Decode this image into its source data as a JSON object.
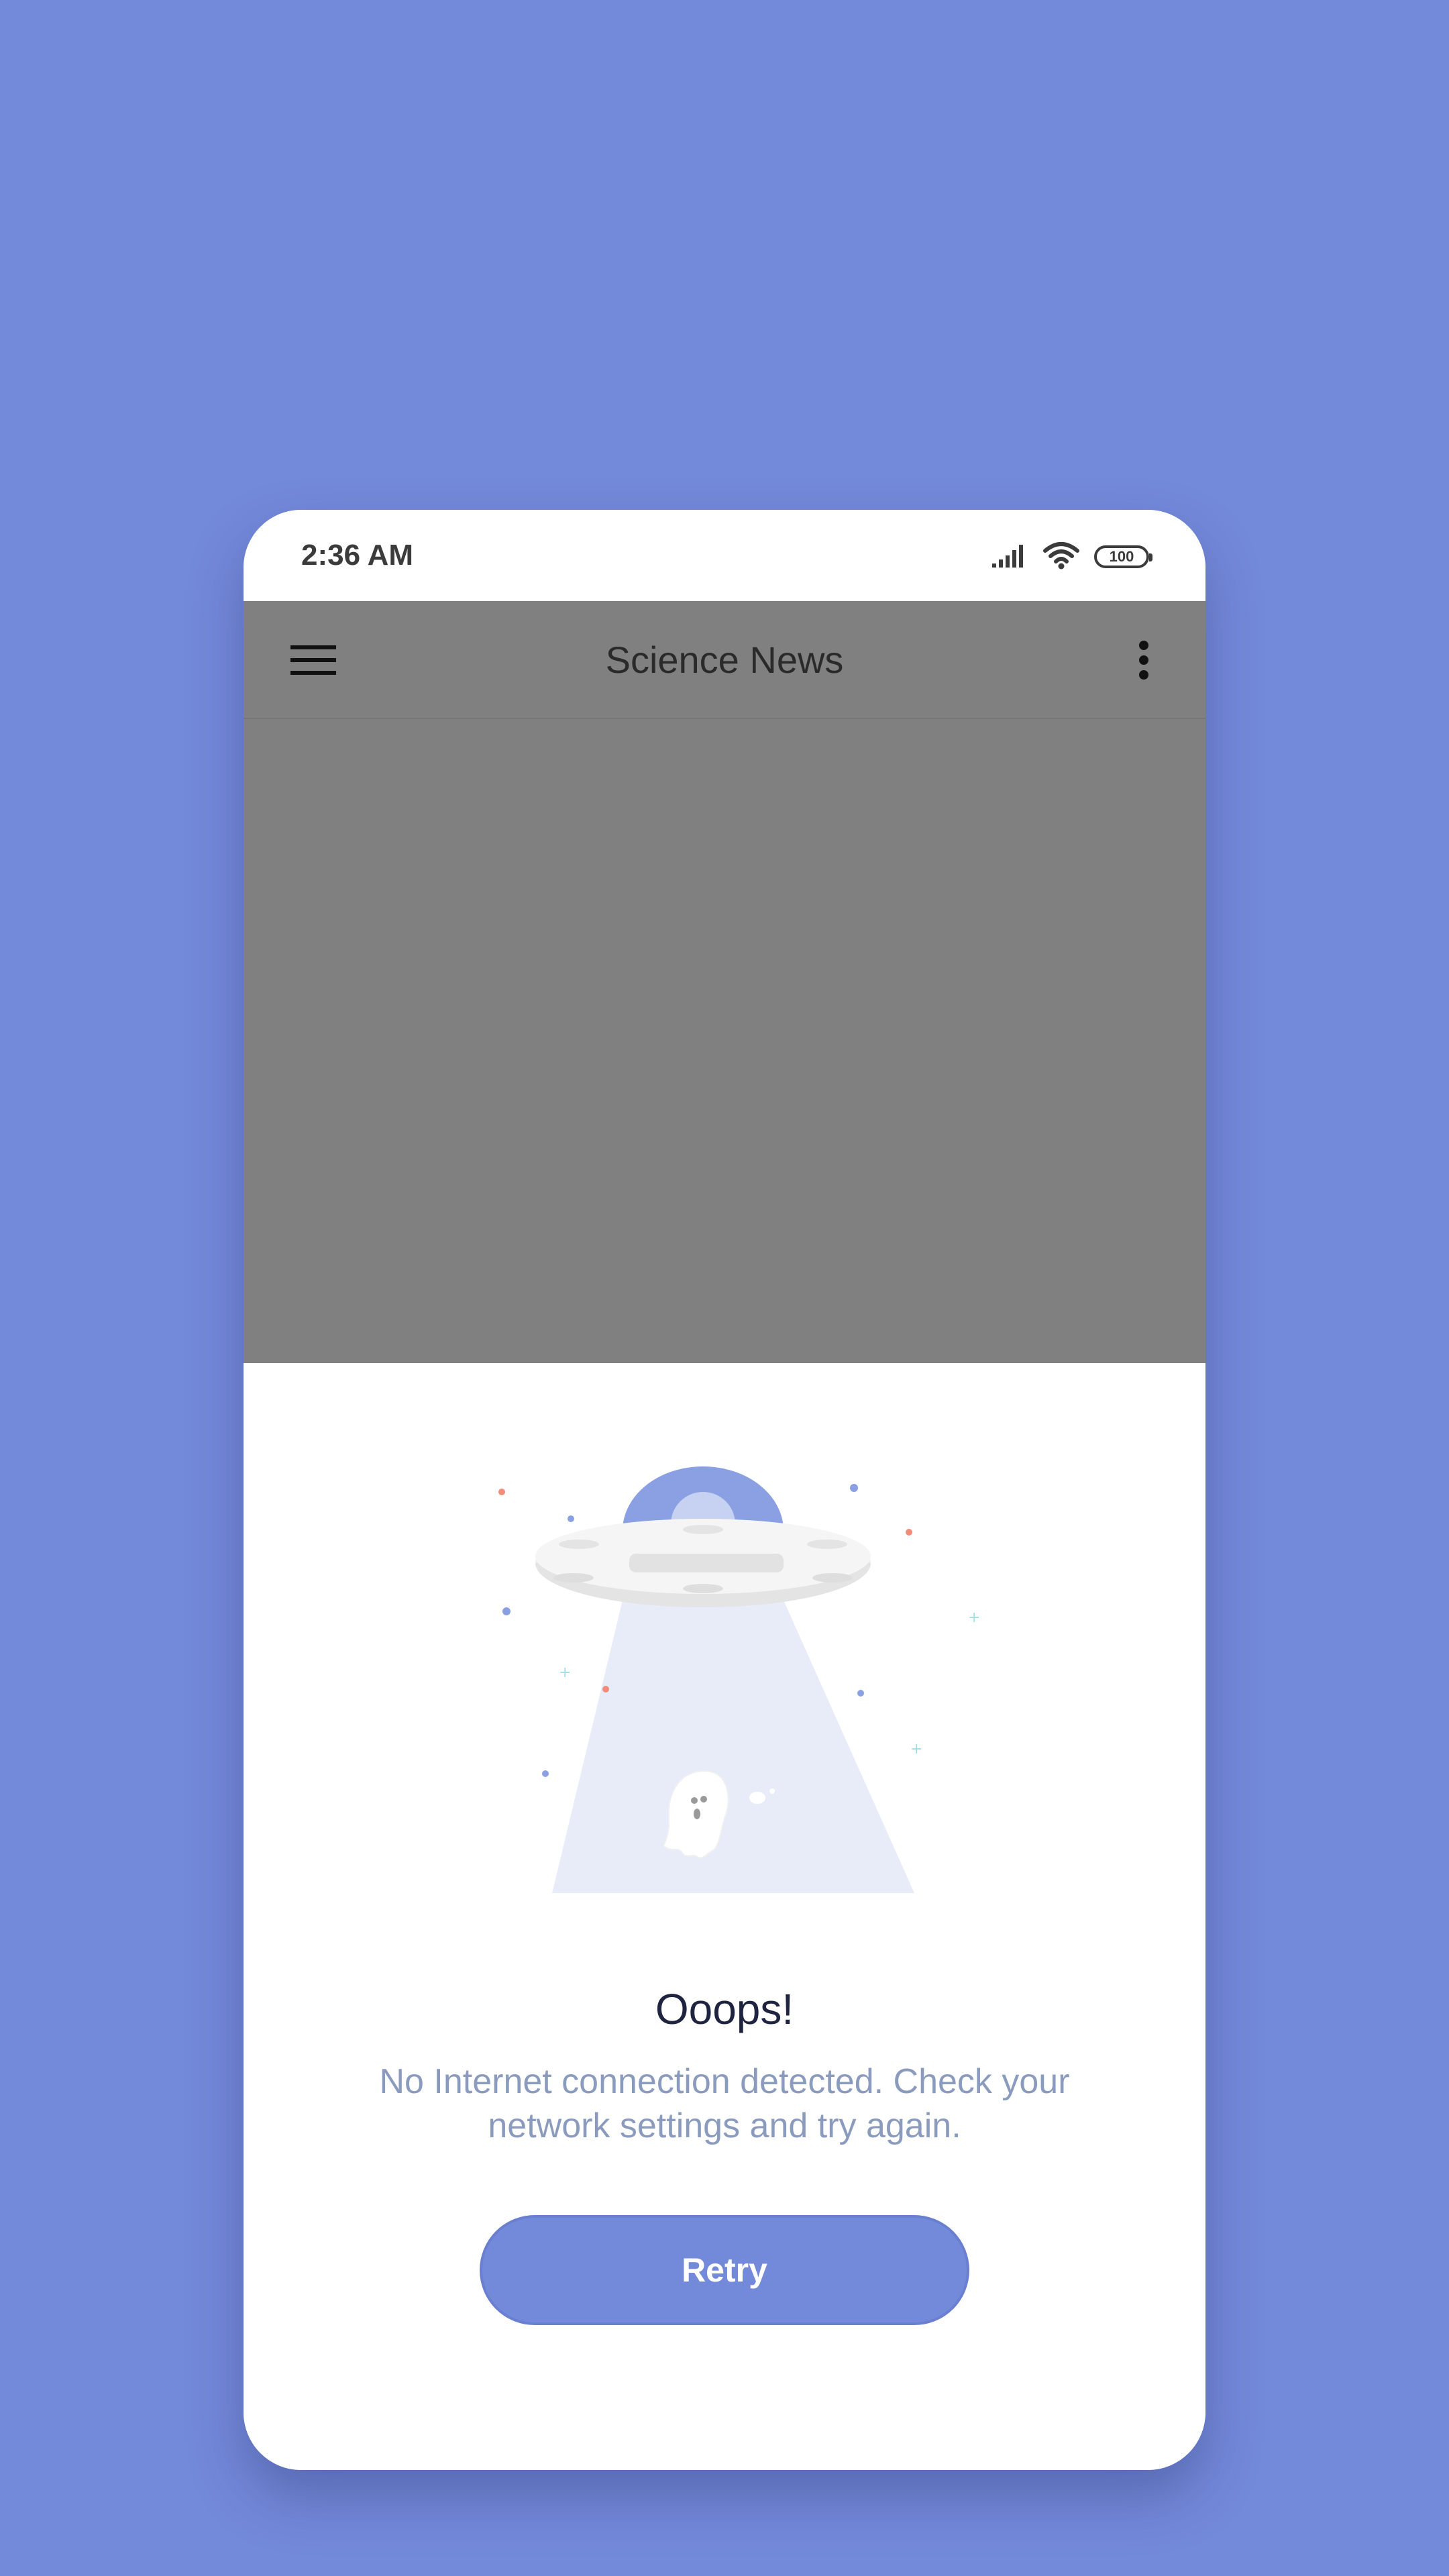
{
  "status_bar": {
    "time": "2:36 AM",
    "battery": "100",
    "icons": [
      "signal-icon",
      "wifi-icon",
      "battery-icon"
    ]
  },
  "app_bar": {
    "title": "Science News",
    "menu_icon": "hamburger-menu-icon",
    "more_icon": "more-vert-icon"
  },
  "error": {
    "illustration": "ufo-ghost-illustration",
    "title": "Ooops!",
    "message": "No Internet connection detected. Check your network settings and try again.",
    "retry_label": "Retry"
  },
  "colors": {
    "background": "#7389d9",
    "accent": "#7389d9",
    "scrim": "#808080",
    "title_text": "#1f2440",
    "message_text": "#8a9bbd"
  }
}
